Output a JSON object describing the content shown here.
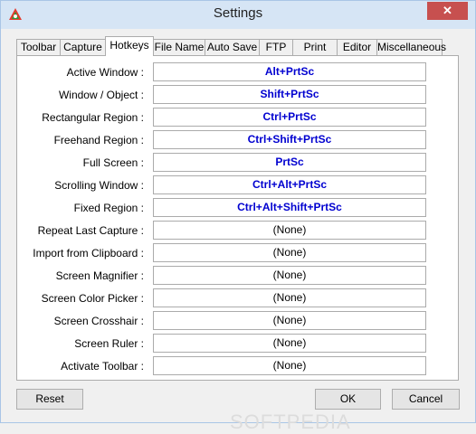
{
  "window": {
    "title": "Settings",
    "close_glyph": "✕",
    "app_icon": "app-icon"
  },
  "tabs": [
    {
      "label": "Toolbar"
    },
    {
      "label": "Capture"
    },
    {
      "label": "Hotkeys",
      "active": true
    },
    {
      "label": "File Name"
    },
    {
      "label": "Auto Save"
    },
    {
      "label": "FTP"
    },
    {
      "label": "Print"
    },
    {
      "label": "Editor"
    },
    {
      "label": "Miscellaneous"
    }
  ],
  "hotkeys": [
    {
      "label": "Active Window :",
      "value": "Alt+PrtSc"
    },
    {
      "label": "Window / Object :",
      "value": "Shift+PrtSc"
    },
    {
      "label": "Rectangular Region :",
      "value": "Ctrl+PrtSc"
    },
    {
      "label": "Freehand Region :",
      "value": "Ctrl+Shift+PrtSc"
    },
    {
      "label": "Full Screen :",
      "value": "PrtSc"
    },
    {
      "label": "Scrolling Window :",
      "value": "Ctrl+Alt+PrtSc"
    },
    {
      "label": "Fixed Region :",
      "value": "Ctrl+Alt+Shift+PrtSc"
    },
    {
      "label": "Repeat Last Capture :",
      "value": "(None)"
    },
    {
      "label": "Import from Clipboard :",
      "value": "(None)"
    },
    {
      "label": "Screen Magnifier :",
      "value": "(None)"
    },
    {
      "label": "Screen Color Picker :",
      "value": "(None)"
    },
    {
      "label": "Screen Crosshair :",
      "value": "(None)"
    },
    {
      "label": "Screen Ruler :",
      "value": "(None)"
    },
    {
      "label": "Activate Toolbar :",
      "value": "(None)"
    }
  ],
  "buttons": {
    "reset": "Reset",
    "ok": "OK",
    "cancel": "Cancel"
  },
  "watermark": "SOFTPEDIA",
  "colors": {
    "assigned_hotkey": "#0000d0",
    "titlebar": "#d6e5f5",
    "close": "#c7504f"
  }
}
